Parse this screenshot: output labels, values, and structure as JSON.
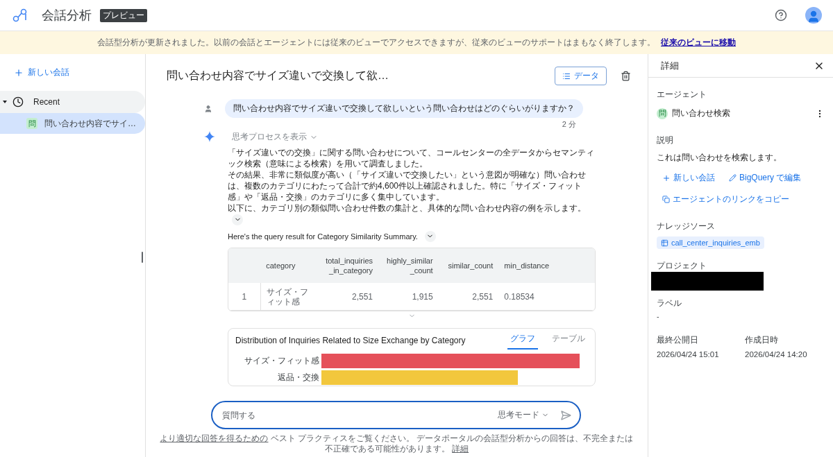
{
  "app": {
    "title": "会話分析",
    "badge": "プレビュー"
  },
  "banner": {
    "text": "会話型分析が更新されました。以前の会話とエージェントには従来のビューでアクセスできますが、従来のビューのサポートはまもなく終了します。",
    "link": "従来のビューに移動"
  },
  "sidebar": {
    "new_chat": "新しい会話",
    "sections": [
      {
        "label": "Recent",
        "expanded": true,
        "children": [
          {
            "badge": "問",
            "label": "問い合わせ内容でサイ…",
            "selected": true
          }
        ]
      }
    ]
  },
  "conversation": {
    "title": "問い合わせ内容でサイズ違いで交換して欲…",
    "data_button": "データ",
    "question": "問い合わせ内容でサイズ違いで交換して欲しいという問い合わせはどのぐらいがりますか？",
    "time": "2 分",
    "answer": {
      "thinking": "思考プロセスを表示",
      "paragraphs": [
        "「サイズ違いでの交換」に関する問い合わせについて、コールセンターの全データからセマンティック検索（意味による検索）を用いて調査しました。",
        "その結果、非常に類似度が高い（「サイズ違いで交換したい」という意図が明確な）問い合わせは、複数のカテゴリにわたって合計で約4,600件以上確認されました。特に「サイズ・フィット感」や「返品・交換」のカテゴリに多く集中しています。",
        "以下に、カテゴリ別の類似問い合わせ件数の集計と、具体的な問い合わせ内容の例を示します。"
      ],
      "query_note": "Here's the query result for Category Similarity Summary.",
      "table": {
        "columns": [
          "category",
          "total_inquiries_in_category",
          "highly_similar_count",
          "similar_count",
          "min_distance"
        ],
        "rows": [
          {
            "index": "1",
            "cells": [
              "サイズ・フィット感",
              "2,551",
              "1,915",
              "2,551",
              "0.18534"
            ]
          }
        ]
      },
      "chart": {
        "title": "Distribution of Inquiries Related to Size Exchange by Category",
        "tabs": [
          {
            "label": "グラフ",
            "selected": true
          },
          {
            "label": "テーブル",
            "selected": false
          }
        ],
        "bars": [
          {
            "label": "サイズ・フィット感",
            "color": "#e5505a"
          },
          {
            "label": "返品・交換",
            "color": "#f2c73d"
          }
        ]
      }
    }
  },
  "input": {
    "placeholder": "質問する",
    "mode": "思考モード"
  },
  "footer": [
    {
      "kind": "link",
      "text": "より適切な回答を得るための"
    },
    {
      "kind": "text",
      "text": " ベスト プラクティスをご覧ください。 データポータルの会話型分析からの回答は、不完全または不正確である可能性があります。 "
    },
    {
      "kind": "link",
      "text": "詳細"
    }
  ],
  "details": {
    "title": "詳細",
    "agent_label": "エージェント",
    "agent": {
      "badge": "問",
      "name": "問い合わせ検索"
    },
    "description_label": "説明",
    "description": "これは問い合わせを検索します。",
    "actions": [
      {
        "kind": "new",
        "label": "新しい会話"
      },
      {
        "kind": "edit",
        "label": "BigQuery で編集"
      },
      {
        "kind": "copy",
        "label": "エージェントのリンクをコピー"
      }
    ],
    "knowledge_label": "ナレッジソース",
    "knowledge": "call_center_inquiries_emb",
    "project_label": "プロジェクト",
    "project_redacted": true,
    "label_label": "ラベル",
    "label_value": "-",
    "dates": [
      {
        "label": "最終公開日",
        "value": "2026/04/24 15:01"
      },
      {
        "label": "作成日時",
        "value": "2026/04/24 14:20"
      }
    ]
  }
}
